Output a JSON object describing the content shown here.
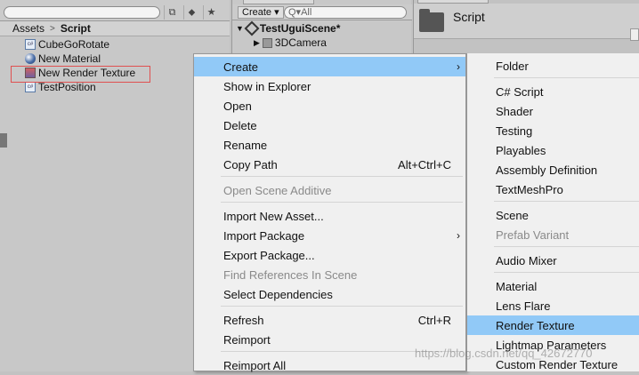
{
  "project": {
    "breadcrumb": [
      "Assets",
      "Script"
    ],
    "items": [
      {
        "label": "CubeGoRotate",
        "icon": "csharp-script-icon"
      },
      {
        "label": "New Material",
        "icon": "material-icon"
      },
      {
        "label": "New Render Texture",
        "icon": "render-texture-icon"
      },
      {
        "label": "TestPosition",
        "icon": "csharp-script-icon"
      }
    ],
    "highlighted_index": 2
  },
  "hierarchy": {
    "create_label": "Create ▾",
    "search_placeholder": "Q▾All",
    "scene_name": "TestUguiScene*",
    "child": "3DCamera"
  },
  "inspector": {
    "title": "Script"
  },
  "menu": {
    "items": [
      {
        "label": "Create",
        "submenu": true,
        "selected": true
      },
      {
        "label": "Show in Explorer"
      },
      {
        "label": "Open"
      },
      {
        "label": "Delete"
      },
      {
        "label": "Rename"
      },
      {
        "label": "Copy Path",
        "shortcut": "Alt+Ctrl+C"
      },
      {
        "label": "Open Scene Additive",
        "disabled": true
      },
      {
        "label": "Import New Asset..."
      },
      {
        "label": "Import Package",
        "submenu": true
      },
      {
        "label": "Export Package..."
      },
      {
        "label": "Find References In Scene",
        "disabled": true
      },
      {
        "label": "Select Dependencies"
      },
      {
        "label": "Refresh",
        "shortcut": "Ctrl+R"
      },
      {
        "label": "Reimport"
      },
      {
        "label": "Reimport All"
      }
    ]
  },
  "submenu": {
    "items": [
      {
        "label": "Folder"
      },
      {
        "label": "C# Script"
      },
      {
        "label": "Shader"
      },
      {
        "label": "Testing"
      },
      {
        "label": "Playables"
      },
      {
        "label": "Assembly Definition"
      },
      {
        "label": "TextMeshPro"
      },
      {
        "label": "Scene"
      },
      {
        "label": "Prefab Variant",
        "disabled": true
      },
      {
        "label": "Audio Mixer"
      },
      {
        "label": "Material"
      },
      {
        "label": "Lens Flare"
      },
      {
        "label": "Render Texture",
        "selected": true
      },
      {
        "label": "Lightmap Parameters"
      },
      {
        "label": "Custom Render Texture"
      }
    ]
  },
  "colors": {
    "selection": "#91c9f7",
    "menu_bg": "#f0f0f0",
    "highlight_border": "#e05050"
  },
  "watermark": "https://blog.csdn.net/qq_42672770"
}
